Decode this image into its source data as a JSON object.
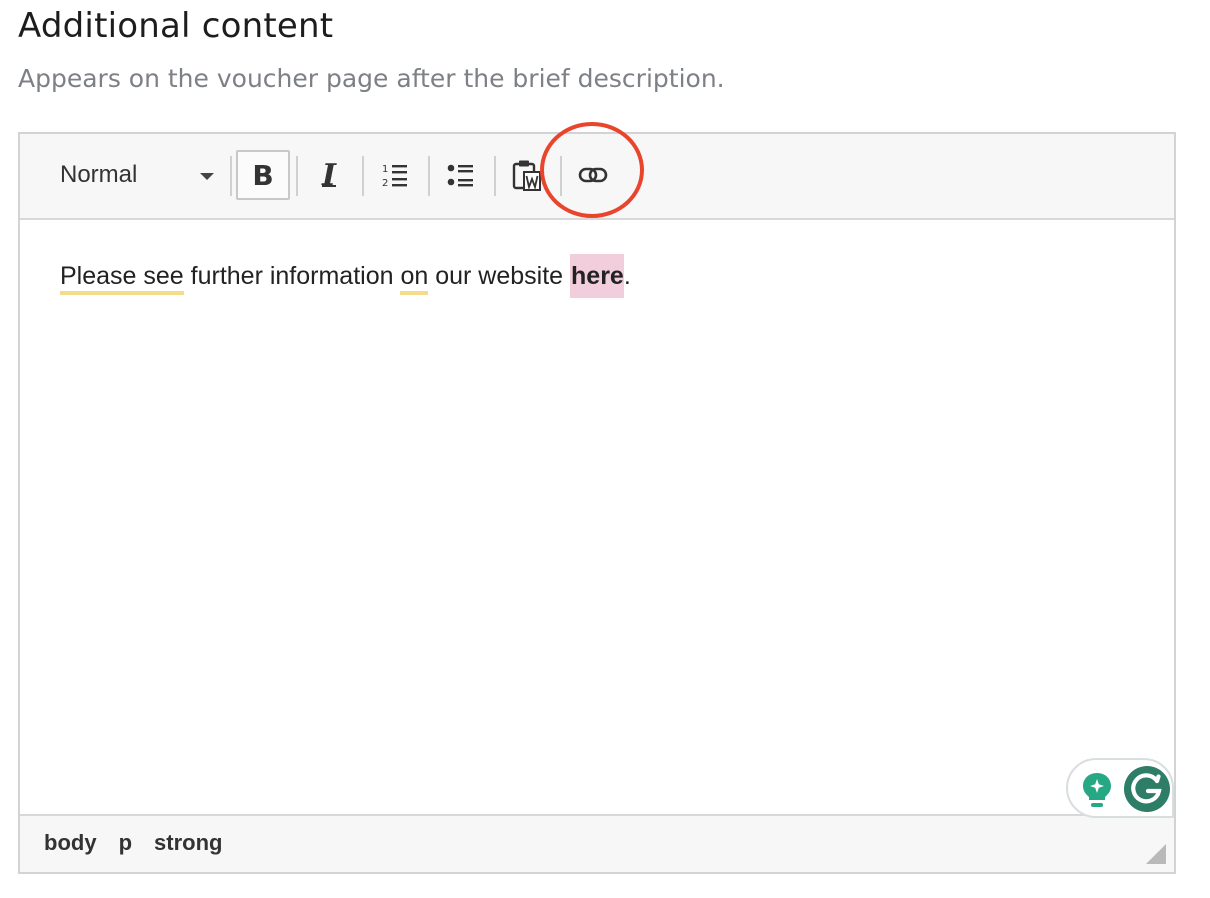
{
  "section": {
    "title": "Additional content",
    "description": "Appears on the voucher page after the brief description."
  },
  "toolbar": {
    "format_value": "Normal",
    "buttons": [
      {
        "name": "bold",
        "icon": "bold-icon",
        "active": true
      },
      {
        "name": "italic",
        "icon": "italic-icon",
        "active": false
      },
      {
        "name": "ordered-list",
        "icon": "ordered-list-icon",
        "active": false
      },
      {
        "name": "bullet-list",
        "icon": "bullet-list-icon",
        "active": false
      },
      {
        "name": "paste-from-word",
        "icon": "paste-word-icon",
        "active": false
      },
      {
        "name": "link",
        "icon": "link-icon",
        "active": false
      }
    ],
    "bold_glyph": "B",
    "italic_glyph": "I"
  },
  "annotation": {
    "color": "#e8452c",
    "target": "link-button"
  },
  "content": {
    "part1": "Please see",
    "part2": " further information ",
    "part3": "on",
    "part4": " our website ",
    "link_text": "here",
    "part5": "."
  },
  "statusbar": {
    "crumbs": [
      "body",
      "p",
      "strong"
    ]
  },
  "grammarly": {
    "logo_letter": "G",
    "accent": "#2e7d67",
    "bulb_color": "#27a884"
  },
  "colors": {
    "underline_flag": "#f4dc8a",
    "link_highlight": "#f2cddb",
    "toolbar_bg": "#f7f7f7",
    "border": "#d3d3d3"
  }
}
